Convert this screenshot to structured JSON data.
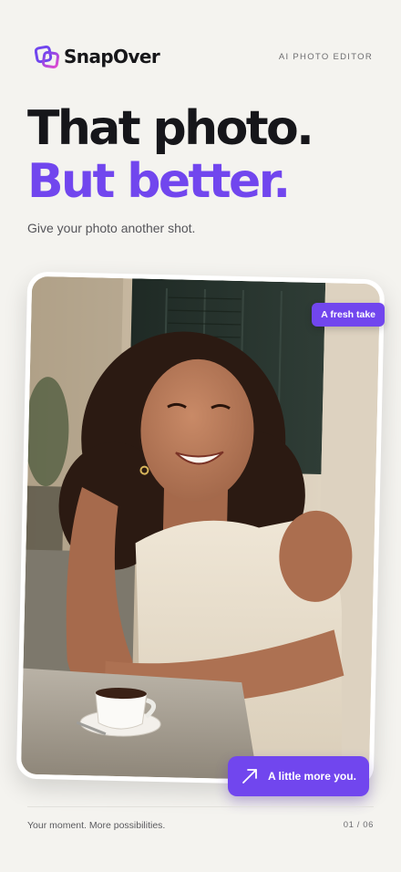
{
  "brand": {
    "name": "SnapOver",
    "tagline": "AI PHOTO EDITOR",
    "logo_icon": "stacked-squares-logo-icon",
    "logo_colors": [
      "#7146ee",
      "#e24bd0"
    ]
  },
  "hero": {
    "line1": "That photo.",
    "line2": "But better.",
    "subtitle": "Give your photo another shot."
  },
  "photo": {
    "chip_top": "A fresh take",
    "chip_bottom": "A little more you.",
    "chip_bottom_icon": "arrow-up-right-icon"
  },
  "footer": {
    "caption": "Your moment. More possibilities.",
    "pager": "01 / 06"
  },
  "colors": {
    "accent": "#7146ee",
    "background": "#f4f3ef",
    "text": "#16161a"
  }
}
